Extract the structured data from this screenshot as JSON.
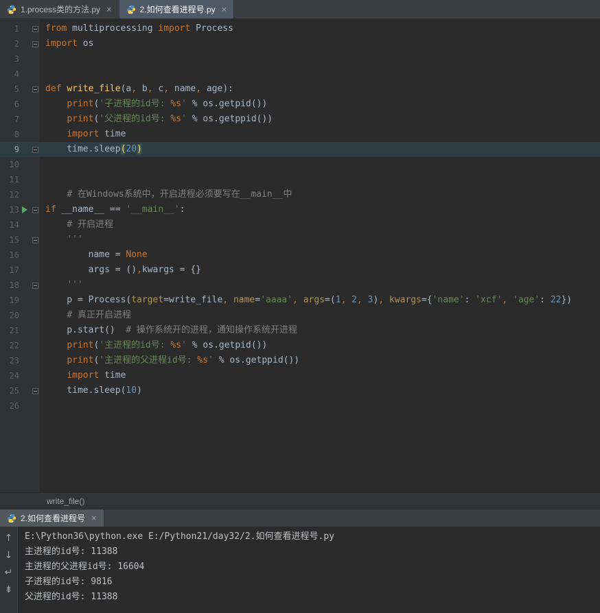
{
  "ui": {
    "close_glyph": "×"
  },
  "editor_tabs": [
    {
      "label": "1.process类的方法.py"
    },
    {
      "label": "2.如何查看进程号.py"
    }
  ],
  "breadcrumb": {
    "label": "write_file()"
  },
  "editor": {
    "current_line": 9,
    "run_line": 13,
    "lines": [
      {
        "n": 1,
        "fold": "start",
        "tokens": [
          [
            "kw",
            "from"
          ],
          [
            "pl",
            " multiprocessing "
          ],
          [
            "kw",
            "import"
          ],
          [
            "pl",
            " Process"
          ]
        ]
      },
      {
        "n": 2,
        "fold": "start",
        "tokens": [
          [
            "kw",
            "import"
          ],
          [
            "pl",
            " os"
          ]
        ]
      },
      {
        "n": 3,
        "tokens": []
      },
      {
        "n": 4,
        "tokens": []
      },
      {
        "n": 5,
        "fold": "start",
        "tokens": [
          [
            "kw",
            "def "
          ],
          [
            "fn",
            "write_file"
          ],
          [
            "pl",
            "(a"
          ],
          [
            "cm",
            ","
          ],
          [
            "pl",
            " b"
          ],
          [
            "cm",
            ","
          ],
          [
            "pl",
            " c"
          ],
          [
            "cm",
            ","
          ],
          [
            "pl",
            " name"
          ],
          [
            "cm",
            ","
          ],
          [
            "pl",
            " age"
          ],
          [
            "pl",
            "):"
          ]
        ]
      },
      {
        "n": 6,
        "tokens": [
          [
            "pl",
            "    "
          ],
          [
            "kw",
            "print"
          ],
          [
            "pl",
            "("
          ],
          [
            "str",
            "'子进程的id号: "
          ],
          [
            "fmt",
            "%s"
          ],
          [
            "str",
            "'"
          ],
          [
            "pl",
            " % os.getpid())"
          ]
        ]
      },
      {
        "n": 7,
        "tokens": [
          [
            "pl",
            "    "
          ],
          [
            "kw",
            "print"
          ],
          [
            "pl",
            "("
          ],
          [
            "str",
            "'父进程的id号: "
          ],
          [
            "fmt",
            "%s"
          ],
          [
            "str",
            "'"
          ],
          [
            "pl",
            " % os.getppid())"
          ]
        ]
      },
      {
        "n": 8,
        "tokens": [
          [
            "pl",
            "    "
          ],
          [
            "kw",
            "import"
          ],
          [
            "pl",
            " time"
          ]
        ]
      },
      {
        "n": 9,
        "current": true,
        "fold": "end",
        "tokens": [
          [
            "pl",
            "    time.sleep"
          ],
          [
            "match",
            "("
          ],
          [
            "num",
            "20"
          ],
          [
            "match",
            ")"
          ]
        ]
      },
      {
        "n": 10,
        "tokens": []
      },
      {
        "n": 11,
        "tokens": []
      },
      {
        "n": 12,
        "tokens": [
          [
            "pl",
            "    "
          ],
          [
            "com",
            "# 在Windows系统中，开启进程必须要写在__main__中"
          ]
        ]
      },
      {
        "n": 13,
        "run": true,
        "fold": "start",
        "tokens": [
          [
            "kw",
            "if"
          ],
          [
            "pl",
            " __name__ == "
          ],
          [
            "str",
            "'__main__'"
          ],
          [
            "pl",
            ":"
          ]
        ]
      },
      {
        "n": 14,
        "tokens": [
          [
            "pl",
            "    "
          ],
          [
            "com",
            "# 开启进程"
          ]
        ]
      },
      {
        "n": 15,
        "fold": "start",
        "tokens": [
          [
            "pl",
            "    "
          ],
          [
            "str",
            "'''"
          ]
        ]
      },
      {
        "n": 16,
        "tokens": [
          [
            "pl",
            "        name = "
          ],
          [
            "kw",
            "None"
          ]
        ]
      },
      {
        "n": 17,
        "tokens": [
          [
            "pl",
            "        args = ()"
          ],
          [
            "cm",
            ","
          ],
          [
            "pl",
            "kwargs = {}"
          ]
        ]
      },
      {
        "n": 18,
        "fold": "end",
        "tokens": [
          [
            "pl",
            "    "
          ],
          [
            "str",
            "'''"
          ]
        ]
      },
      {
        "n": 19,
        "tokens": [
          [
            "pl",
            "    p = Process("
          ],
          [
            "kwarg",
            "target"
          ],
          [
            "pl",
            "=write_file"
          ],
          [
            "cm",
            ","
          ],
          [
            "pl",
            " "
          ],
          [
            "kwarg",
            "name"
          ],
          [
            "pl",
            "="
          ],
          [
            "str",
            "'aaaa'"
          ],
          [
            "cm",
            ","
          ],
          [
            "pl",
            " "
          ],
          [
            "kwarg",
            "args"
          ],
          [
            "pl",
            "=("
          ],
          [
            "num",
            "1"
          ],
          [
            "cm",
            ","
          ],
          [
            "pl",
            " "
          ],
          [
            "num",
            "2"
          ],
          [
            "cm",
            ","
          ],
          [
            "pl",
            " "
          ],
          [
            "num",
            "3"
          ],
          [
            "pl",
            ")"
          ],
          [
            "cm",
            ","
          ],
          [
            "pl",
            " "
          ],
          [
            "kwarg",
            "kwargs"
          ],
          [
            "pl",
            "={"
          ],
          [
            "str",
            "'name'"
          ],
          [
            "pl",
            ": "
          ],
          [
            "str",
            "'xcf'"
          ],
          [
            "cm",
            ","
          ],
          [
            "pl",
            " "
          ],
          [
            "str",
            "'age'"
          ],
          [
            "pl",
            ": "
          ],
          [
            "num",
            "22"
          ],
          [
            "pl",
            "})"
          ]
        ]
      },
      {
        "n": 20,
        "tokens": [
          [
            "pl",
            "    "
          ],
          [
            "com",
            "# 真正开启进程"
          ]
        ]
      },
      {
        "n": 21,
        "tokens": [
          [
            "pl",
            "    p.start()  "
          ],
          [
            "com",
            "# 操作系统开的进程，通知操作系统开进程"
          ]
        ]
      },
      {
        "n": 22,
        "tokens": [
          [
            "pl",
            "    "
          ],
          [
            "kw",
            "print"
          ],
          [
            "pl",
            "("
          ],
          [
            "str",
            "'主进程的id号: "
          ],
          [
            "fmt",
            "%s"
          ],
          [
            "str",
            "'"
          ],
          [
            "pl",
            " % os.getpid())"
          ]
        ]
      },
      {
        "n": 23,
        "tokens": [
          [
            "pl",
            "    "
          ],
          [
            "kw",
            "print"
          ],
          [
            "pl",
            "("
          ],
          [
            "str",
            "'主进程的父进程id号: "
          ],
          [
            "fmt",
            "%s"
          ],
          [
            "str",
            "'"
          ],
          [
            "pl",
            " % os.getppid())"
          ]
        ]
      },
      {
        "n": 24,
        "tokens": [
          [
            "pl",
            "    "
          ],
          [
            "kw",
            "import"
          ],
          [
            "pl",
            " time"
          ]
        ]
      },
      {
        "n": 25,
        "fold": "end",
        "tokens": [
          [
            "pl",
            "    time.sleep("
          ],
          [
            "num",
            "10"
          ],
          [
            "pl",
            ")"
          ]
        ]
      },
      {
        "n": 26,
        "tokens": []
      }
    ]
  },
  "run_panel": {
    "tab_label": "2.如何查看进程号",
    "icons": [
      {
        "name": "scroll-up-icon",
        "glyph": "↑"
      },
      {
        "name": "scroll-down-icon",
        "glyph": "↓"
      },
      {
        "name": "soft-wrap-icon",
        "glyph": "↵"
      },
      {
        "name": "scroll-to-end-icon",
        "glyph": "⇟"
      }
    ],
    "console_lines": [
      "E:\\Python36\\python.exe E:/Python21/day32/2.如何查看进程号.py",
      "主进程的id号: 11388",
      "主进程的父进程id号: 16604",
      "子进程的id号: 9816",
      "父进程的id号: 11388"
    ]
  },
  "colors": {
    "editor_bg": "#2b2b2b",
    "gutter_bg": "#2f3335",
    "tabbar_bg": "#3c3f41",
    "active_tab_bg": "#4e5866",
    "keyword": "#cc7832",
    "function_def": "#ffc66d",
    "string": "#6a8759",
    "number": "#6897bb",
    "comment": "#808080",
    "text": "#a9b7c6",
    "keyword_argument": "#ad9456",
    "run_arrow_green": "#59a869",
    "current_line_bg": "#2e3d44"
  }
}
